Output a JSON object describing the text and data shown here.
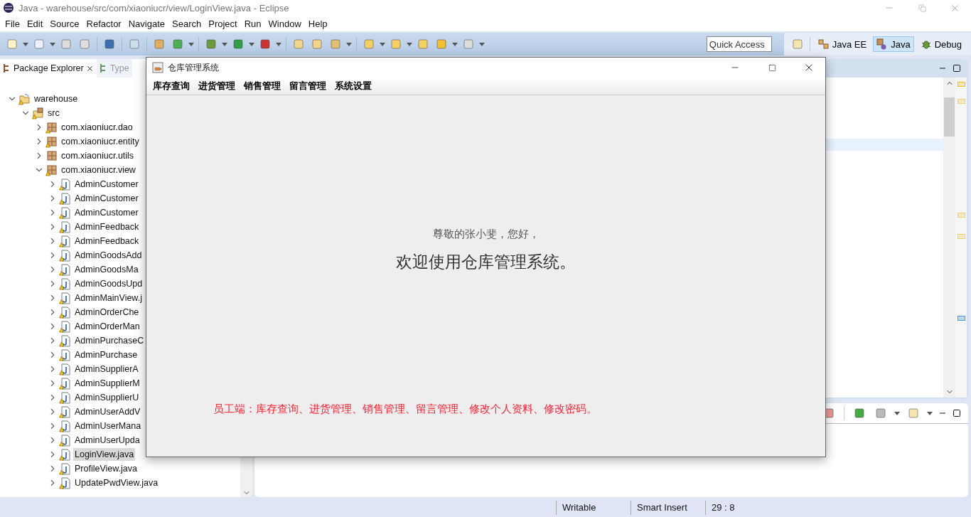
{
  "window": {
    "title": "Java - warehouse/src/com/xiaoniucr/view/LoginView.java - Eclipse"
  },
  "menu": [
    "File",
    "Edit",
    "Source",
    "Refactor",
    "Navigate",
    "Search",
    "Project",
    "Run",
    "Window",
    "Help"
  ],
  "quick_access": {
    "placeholder": "Quick Access"
  },
  "perspectives": [
    {
      "label": "Java EE",
      "kind": "javaee",
      "selected": false
    },
    {
      "label": "Java",
      "kind": "java",
      "selected": true
    },
    {
      "label": "Debug",
      "kind": "debug",
      "selected": false
    }
  ],
  "package_explorer": {
    "tabs": [
      {
        "label": "Package Explorer",
        "selected": true
      },
      {
        "label": "Type",
        "selected": false
      }
    ],
    "tree": [
      {
        "label": "warehouse",
        "kind": "project",
        "warning": true,
        "expanded": true,
        "selected": false,
        "children": [
          {
            "label": "src",
            "kind": "source-folder",
            "warning": true,
            "expanded": true,
            "selected": false,
            "children": [
              {
                "label": "com.xiaoniucr.dao",
                "kind": "package",
                "warning": true,
                "expanded": false,
                "selected": false
              },
              {
                "label": "com.xiaoniucr.entity",
                "kind": "package",
                "warning": true,
                "expanded": false,
                "selected": false
              },
              {
                "label": "com.xiaoniucr.utils",
                "kind": "package",
                "warning": false,
                "expanded": false,
                "selected": false
              },
              {
                "label": "com.xiaoniucr.view",
                "kind": "package",
                "warning": true,
                "expanded": true,
                "selected": false,
                "children": [
                  {
                    "label": "AdminCustomer",
                    "kind": "java-file",
                    "warning": true,
                    "expanded": false,
                    "selected": false
                  },
                  {
                    "label": "AdminCustomer",
                    "kind": "java-file",
                    "warning": true,
                    "expanded": false,
                    "selected": false
                  },
                  {
                    "label": "AdminCustomer",
                    "kind": "java-file",
                    "warning": true,
                    "expanded": false,
                    "selected": false
                  },
                  {
                    "label": "AdminFeedback",
                    "kind": "java-file",
                    "warning": true,
                    "expanded": false,
                    "selected": false
                  },
                  {
                    "label": "AdminFeedback",
                    "kind": "java-file",
                    "warning": true,
                    "expanded": false,
                    "selected": false
                  },
                  {
                    "label": "AdminGoodsAdd",
                    "kind": "java-file",
                    "warning": true,
                    "expanded": false,
                    "selected": false
                  },
                  {
                    "label": "AdminGoodsMa",
                    "kind": "java-file",
                    "warning": true,
                    "expanded": false,
                    "selected": false
                  },
                  {
                    "label": "AdminGoodsUpd",
                    "kind": "java-file",
                    "warning": true,
                    "expanded": false,
                    "selected": false
                  },
                  {
                    "label": "AdminMainView.j",
                    "kind": "java-file",
                    "warning": true,
                    "expanded": false,
                    "selected": false
                  },
                  {
                    "label": "AdminOrderChe",
                    "kind": "java-file",
                    "warning": true,
                    "expanded": false,
                    "selected": false
                  },
                  {
                    "label": "AdminOrderMan",
                    "kind": "java-file",
                    "warning": true,
                    "expanded": false,
                    "selected": false
                  },
                  {
                    "label": "AdminPurchaseC",
                    "kind": "java-file",
                    "warning": true,
                    "expanded": false,
                    "selected": false
                  },
                  {
                    "label": "AdminPurchase",
                    "kind": "java-file",
                    "warning": true,
                    "expanded": false,
                    "selected": false
                  },
                  {
                    "label": "AdminSupplierA",
                    "kind": "java-file",
                    "warning": true,
                    "expanded": false,
                    "selected": false
                  },
                  {
                    "label": "AdminSupplierM",
                    "kind": "java-file",
                    "warning": true,
                    "expanded": false,
                    "selected": false
                  },
                  {
                    "label": "AdminSupplierU",
                    "kind": "java-file",
                    "warning": true,
                    "expanded": false,
                    "selected": false
                  },
                  {
                    "label": "AdminUserAddV",
                    "kind": "java-file",
                    "warning": true,
                    "expanded": false,
                    "selected": false
                  },
                  {
                    "label": "AdminUserMana",
                    "kind": "java-file",
                    "warning": true,
                    "expanded": false,
                    "selected": false
                  },
                  {
                    "label": "AdminUserUpda",
                    "kind": "java-file",
                    "warning": true,
                    "expanded": false,
                    "selected": false
                  },
                  {
                    "label": "LoginView.java",
                    "kind": "java-file",
                    "warning": true,
                    "expanded": false,
                    "selected": true
                  },
                  {
                    "label": "ProfileView.java",
                    "kind": "java-file",
                    "warning": true,
                    "expanded": false,
                    "selected": false
                  },
                  {
                    "label": "UpdatePwdView.java",
                    "kind": "java-file",
                    "warning": true,
                    "expanded": false,
                    "selected": false
                  }
                ]
              }
            ]
          }
        ]
      }
    ]
  },
  "dialog": {
    "title": "仓库管理系统",
    "menu": [
      "库存查询",
      "进货管理",
      "销售管理",
      "留言管理",
      "系统设置"
    ],
    "greeting": "尊敬的张小斐，您好，",
    "heading": "欢迎使用仓库管理系统。",
    "notice": "员工端：库存查询、进货管理、销售管理、留言管理、修改个人资料、修改密码。"
  },
  "status_bar": [
    "Writable",
    "Smart Insert",
    "29 : 8"
  ]
}
